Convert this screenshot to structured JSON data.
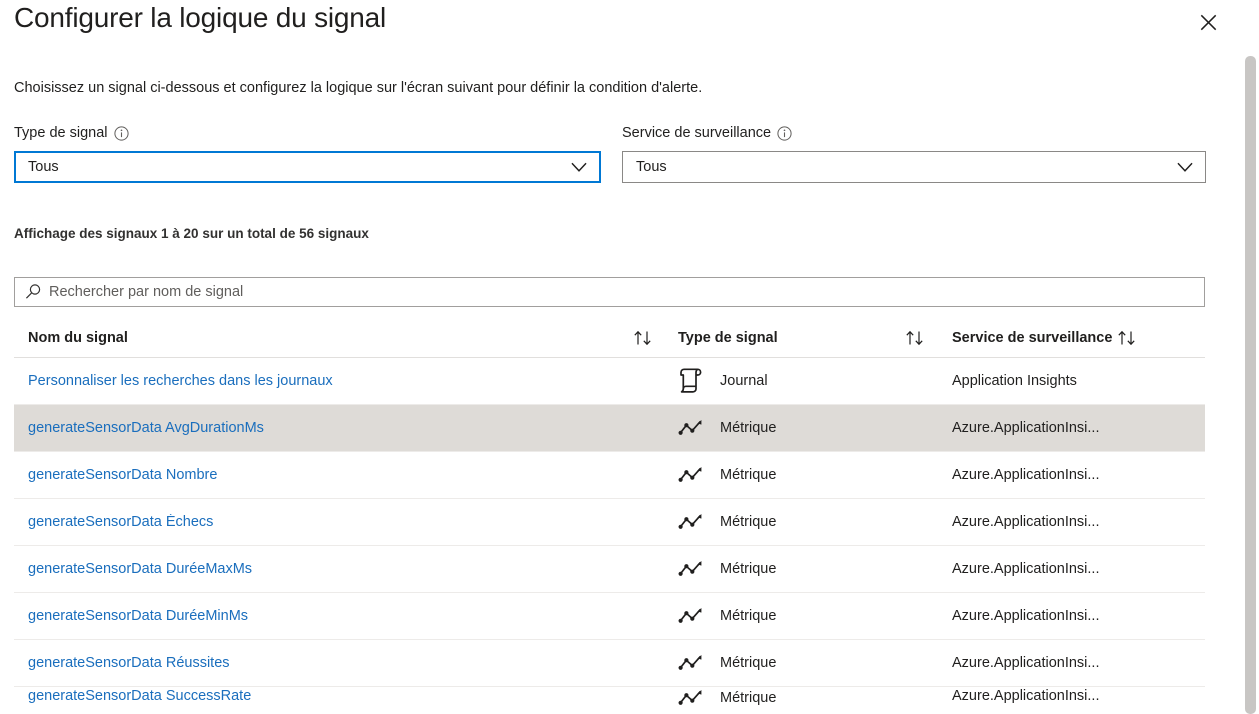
{
  "header": {
    "title": "Configurer la logique du signal",
    "close_icon": "close-icon",
    "description": "Choisissez un signal ci-dessous et configurez la logique sur l'écran suivant pour définir la condition d'alerte."
  },
  "filters": {
    "signal_type": {
      "label": "Type de signal",
      "info_icon": "info-icon",
      "value": "Tous",
      "chevron_icon": "chevron-down-icon",
      "focused": true
    },
    "monitor_service": {
      "label": "Service de surveillance",
      "info_icon": "info-icon",
      "value": "Tous",
      "chevron_icon": "chevron-down-icon",
      "focused": false
    }
  },
  "count_text": "Affichage des signaux 1 à 20 sur un total de 56 signaux",
  "search": {
    "icon": "search-icon",
    "value": "",
    "placeholder": "Rechercher par nom de signal"
  },
  "table": {
    "columns": [
      {
        "label": "Nom du signal",
        "sort_icon": "sort-ascending-descending-icon"
      },
      {
        "label": "Type de signal",
        "sort_icon": "sort-ascending-descending-icon"
      },
      {
        "label": "Service de surveillance",
        "sort_icon": "sort-ascending-descending-icon"
      }
    ],
    "rows": [
      {
        "name": "Personnaliser les recherches dans les journaux",
        "type": "Journal",
        "type_icon": "log-scroll-icon",
        "service": "Application Insights",
        "selected": false
      },
      {
        "name": "generateSensorData AvgDurationMs",
        "type": "Métrique",
        "type_icon": "metric-line-chart-icon",
        "service": "Azure.ApplicationInsi...",
        "selected": true
      },
      {
        "name": "generateSensorData Nombre",
        "type": "Métrique",
        "type_icon": "metric-line-chart-icon",
        "service": "Azure.ApplicationInsi...",
        "selected": false
      },
      {
        "name": "generateSensorData Échecs",
        "type": "Métrique",
        "type_icon": "metric-line-chart-icon",
        "service": "Azure.ApplicationInsi...",
        "selected": false
      },
      {
        "name": "generateSensorData DuréeMaxMs",
        "type": "Métrique",
        "type_icon": "metric-line-chart-icon",
        "service": "Azure.ApplicationInsi...",
        "selected": false
      },
      {
        "name": "generateSensorData DuréeMinMs",
        "type": "Métrique",
        "type_icon": "metric-line-chart-icon",
        "service": "Azure.ApplicationInsi...",
        "selected": false
      },
      {
        "name": "generateSensorData Réussites",
        "type": "Métrique",
        "type_icon": "metric-line-chart-icon",
        "service": "Azure.ApplicationInsi...",
        "selected": false
      },
      {
        "name": "generateSensorData SuccessRate",
        "type": "Métrique",
        "type_icon": "metric-line-chart-icon",
        "service": "Azure.ApplicationInsi...",
        "selected": false
      }
    ]
  },
  "colors": {
    "link": "#1a6ebd",
    "accent": "#0078d4",
    "selected_row": "#dedbd7",
    "border": "#8a8886",
    "scrollbar_thumb": "#c8c6c4"
  }
}
